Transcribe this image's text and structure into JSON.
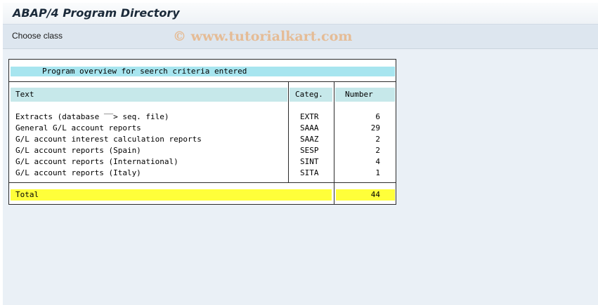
{
  "window": {
    "title": "ABAP/4 Program Directory"
  },
  "toolbar": {
    "choose_class": "Choose class"
  },
  "watermark": "© www.tutorialkart.com",
  "report": {
    "heading": "Program overview for seerch criteria entered",
    "columns": {
      "text": "Text",
      "category": "Categ.",
      "number": "Number"
    },
    "rows": [
      {
        "text": "Extracts (database ‾‾> seq. file)",
        "category": "EXTR",
        "number": "6"
      },
      {
        "text": "General G/L account reports",
        "category": "SAAA",
        "number": "29"
      },
      {
        "text": "G/L account interest calculation reports",
        "category": "SAAZ",
        "number": "2"
      },
      {
        "text": "G/L account reports (Spain)",
        "category": "SESP",
        "number": "2"
      },
      {
        "text": "G/L account reports (International)",
        "category": "SINT",
        "number": "4"
      },
      {
        "text": "G/L account reports (Italy)",
        "category": "SITA",
        "number": "1"
      }
    ],
    "total": {
      "label": "Total",
      "value": "44"
    }
  },
  "colors": {
    "heading_band": "#a7e5ef",
    "column_header_band": "#c6e8ea",
    "total_band": "#ffff3a",
    "background": "#eaf0f6"
  }
}
